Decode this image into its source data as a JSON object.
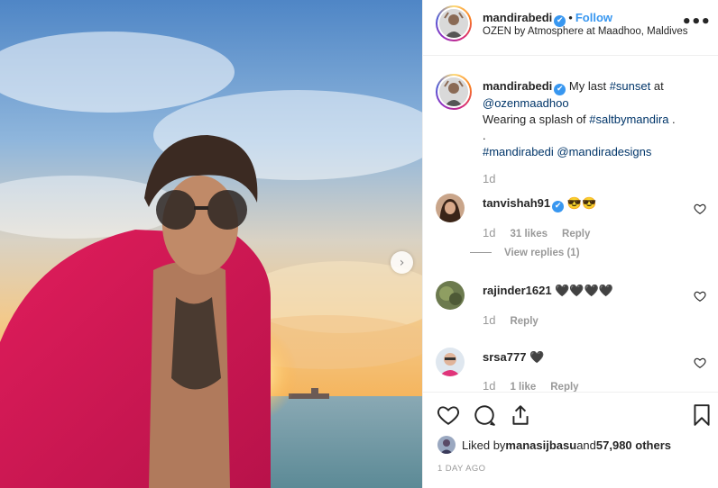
{
  "post": {
    "carousel_next": "›"
  },
  "header": {
    "username": "mandirabedi",
    "verified": "✔",
    "separator": "•",
    "follow_label": "Follow",
    "location": "OZEN by Atmosphere at Maadhoo, Maldives",
    "more_label": "•••"
  },
  "caption": {
    "username": "mandirabedi",
    "verified": "✔",
    "text1": " My last ",
    "tag_sunset": "#sunset",
    "text2": " at",
    "mention_ozen": "@ozenmaadhoo",
    "line2": "Wearing a splash of ",
    "tag_salt": "#saltbymandira",
    "line2_end": " .",
    "line3": ".",
    "tag_mandirabedi": "#mandirabedi",
    "mention_designs": "@mandiradesigns",
    "time": "1d"
  },
  "comments": [
    {
      "username": "tanvishah91",
      "verified": "✔",
      "text": " 😎😎",
      "time": "1d",
      "likes": "31 likes",
      "reply": "Reply",
      "view_replies": "View replies (1)"
    },
    {
      "username": "rajinder1621",
      "text": " 🖤🖤🖤🖤",
      "time": "1d",
      "reply": "Reply"
    },
    {
      "username": "srsa777",
      "text": " 🖤",
      "time": "1d",
      "likes": "1 like",
      "reply": "Reply"
    }
  ],
  "footer": {
    "liked_by_prefix": "Liked by ",
    "liked_by_user": "manasijbasu",
    "liked_by_mid": " and ",
    "liked_by_count": "57,980 others",
    "date": "1 DAY AGO"
  },
  "colors": {
    "link_blue": "#3897f0",
    "hashtag": "#003569",
    "muted": "#999999",
    "text": "#262626"
  },
  "icons": {
    "header_more": "more-options-icon",
    "like": "heart-icon",
    "comment": "comment-icon",
    "share": "share-icon",
    "save": "bookmark-icon",
    "comment_like": "heart-outline-icon",
    "verified": "verified-badge-icon",
    "carousel": "chevron-right-icon"
  }
}
